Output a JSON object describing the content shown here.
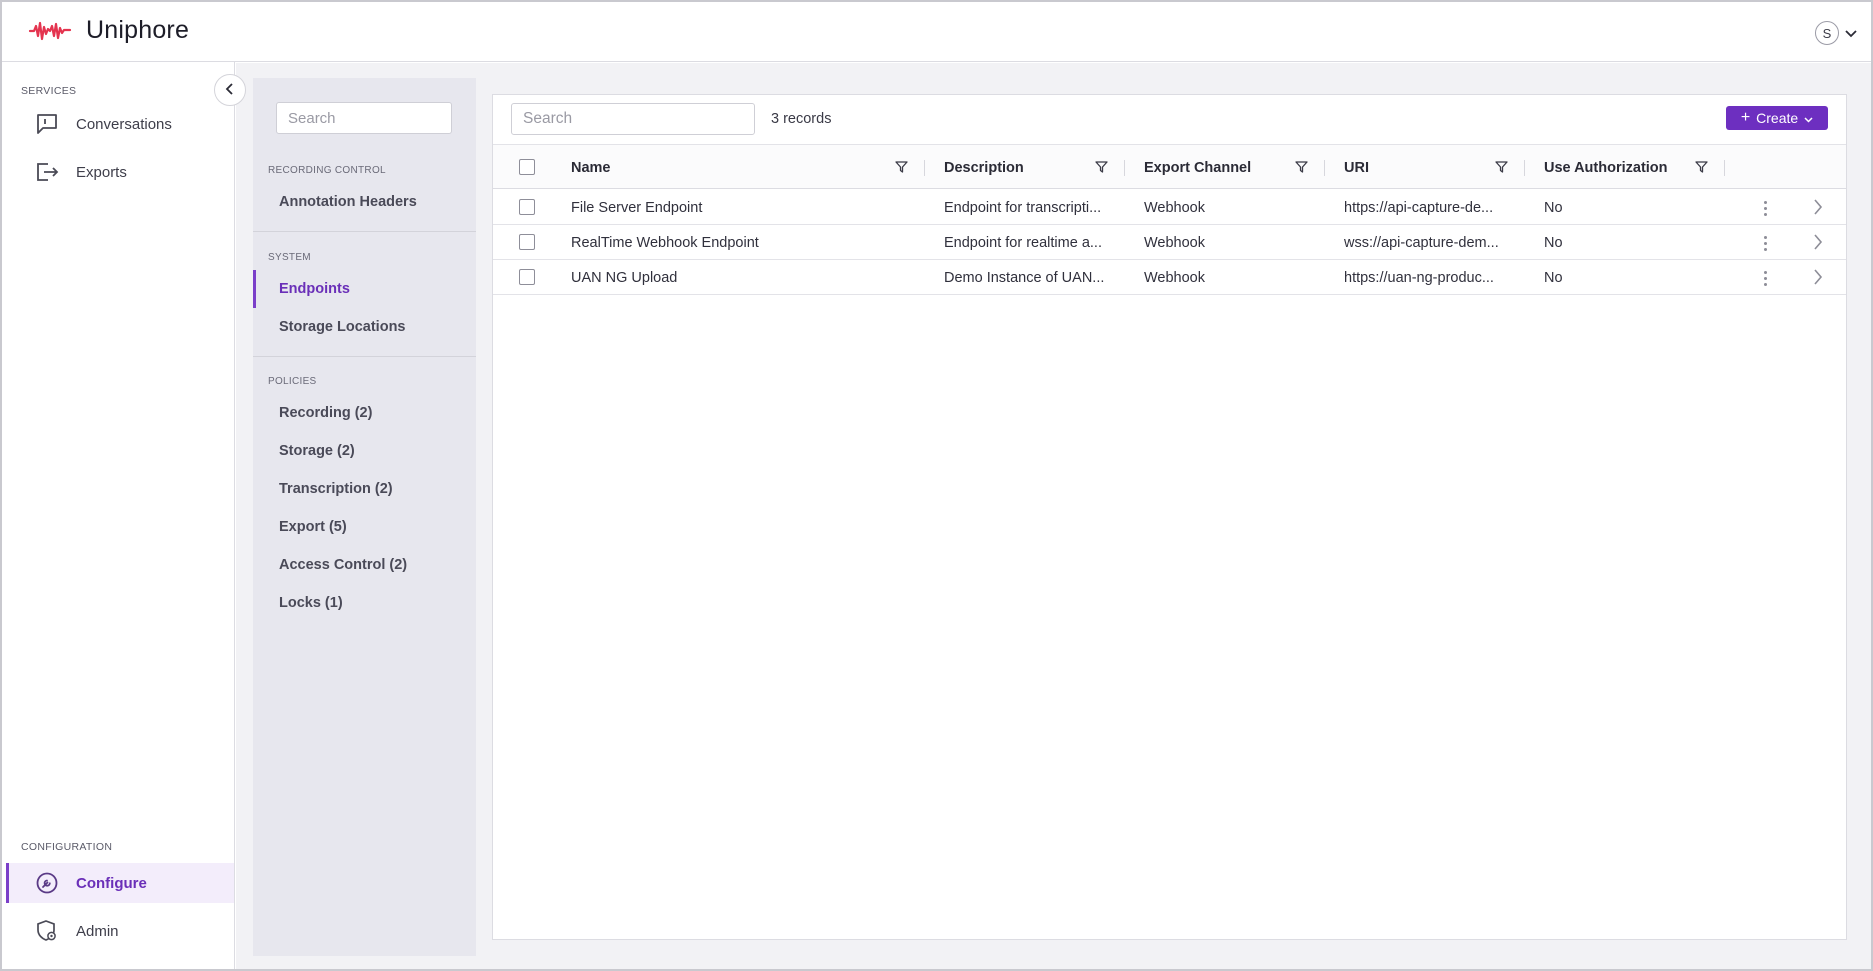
{
  "app": {
    "brand_name": "Uniphore",
    "brand_color": "#e4344f",
    "accent_color": "#6d2fc0",
    "user_initial": "S"
  },
  "leftnav": {
    "services_label": "SERVICES",
    "services": [
      {
        "label": "Conversations",
        "icon": "conversation-icon"
      },
      {
        "label": "Exports",
        "icon": "export-icon"
      }
    ],
    "configuration_label": "CONFIGURATION",
    "configuration": [
      {
        "label": "Configure",
        "icon": "configure-icon",
        "active": true
      },
      {
        "label": "Admin",
        "icon": "admin-icon",
        "active": false
      }
    ]
  },
  "subnav": {
    "search_placeholder": "Search",
    "recording_control_label": "RECORDING CONTROL",
    "recording_control": [
      "Annotation Headers"
    ],
    "system_label": "SYSTEM",
    "system": [
      {
        "label": "Endpoints",
        "active": true
      },
      {
        "label": "Storage Locations",
        "active": false
      }
    ],
    "policies_label": "POLICIES",
    "policies": [
      "Recording (2)",
      "Storage (2)",
      "Transcription (2)",
      "Export (5)",
      "Access Control (2)",
      "Locks (1)"
    ]
  },
  "toolbar": {
    "search_placeholder": "Search",
    "record_count": "3 records",
    "create_label": "Create"
  },
  "table": {
    "columns": [
      "Name",
      "Description",
      "Export Channel",
      "URI",
      "Use Authorization"
    ],
    "rows": [
      {
        "name": "File Server Endpoint",
        "description": "Endpoint for transcripti...",
        "channel": "Webhook",
        "uri": "https://api-capture-de...",
        "auth": "No"
      },
      {
        "name": "RealTime Webhook Endpoint",
        "description": "Endpoint for realtime a...",
        "channel": "Webhook",
        "uri": "wss://api-capture-dem...",
        "auth": "No"
      },
      {
        "name": "UAN NG Upload",
        "description": "Demo Instance of UAN...",
        "channel": "Webhook",
        "uri": "https://uan-ng-produc...",
        "auth": "No"
      }
    ]
  }
}
